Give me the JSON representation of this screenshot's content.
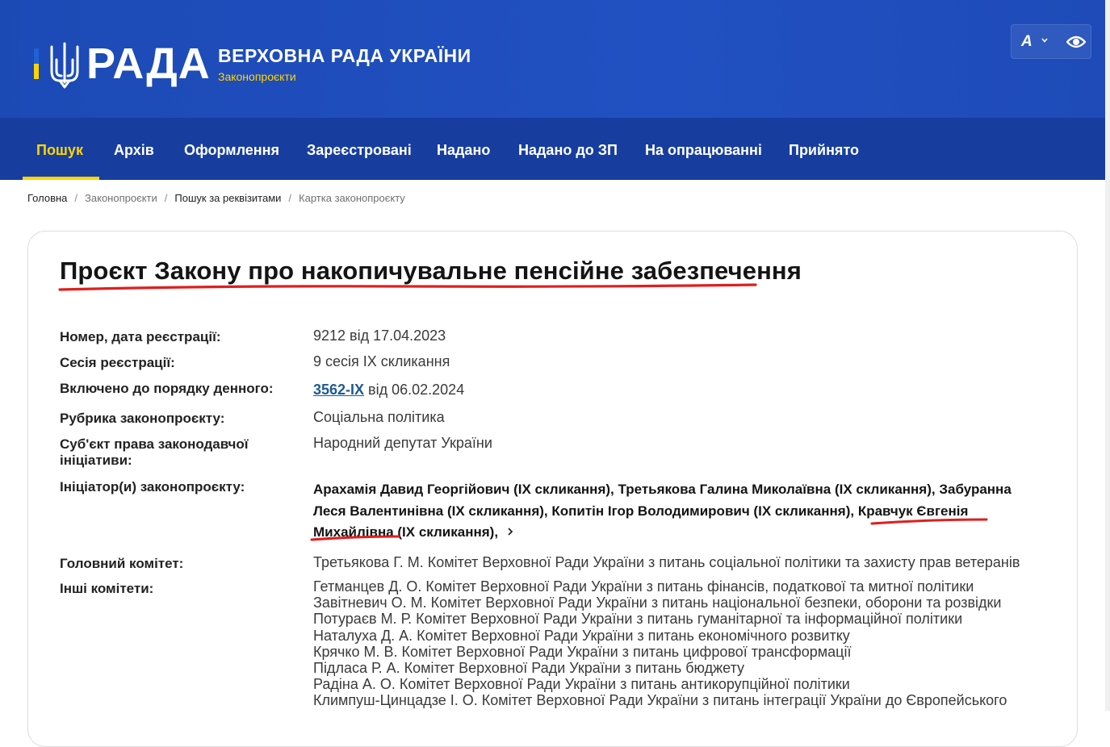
{
  "header": {
    "logo_word": "РАДА",
    "org_name": "ВЕРХОВНА РАДА УКРАЇНИ",
    "org_sub": "Законопроєкти",
    "font_button": "A"
  },
  "nav": {
    "items": [
      {
        "label": "Пошук",
        "active": true
      },
      {
        "label": "Архів"
      },
      {
        "label": "Оформлення"
      },
      {
        "label": "Зареєстровані"
      },
      {
        "label": "Надано"
      },
      {
        "label": "Надано до ЗП"
      },
      {
        "label": "На опрацюванні"
      },
      {
        "label": "Прийнято"
      }
    ]
  },
  "breadcrumbs": [
    "Головна",
    "Законопроєкти",
    "Пошук за реквізитами",
    "Картка законопроєкту"
  ],
  "bill": {
    "title": "Проєкт Закону про накопичувальне пенсійне забезпечення",
    "fields": [
      {
        "label": "Номер, дата реєстрації:",
        "value": "9212 від 17.04.2023"
      },
      {
        "label": "Сесія реєстрації:",
        "value": "9 сесія IX скликання"
      },
      {
        "label": "Включено до порядку денного:",
        "link": "3562-IX",
        "value": " від 06.02.2024"
      },
      {
        "label": "Рубрика законопроєкту:",
        "value": "Соціальна політика"
      },
      {
        "label_line1": "Суб'єкт права законодавчої",
        "label_line2": "ініціативи:",
        "value": "Народний депутат України"
      },
      {
        "label": "Ініціатор(и) законопроєкту:"
      },
      {
        "label": "Головний комітет:",
        "value": "Третьякова Г. М. Комітет Верховної Ради України з питань соціальної політики та захисту прав ветеранів"
      },
      {
        "label": "Інші комітети:"
      }
    ],
    "initiators": [
      "Арахамія Давид Георгійович (IX скликання)",
      "Третьякова Галина Миколаївна (IX скликання)",
      "Забуранна Леся Валентинівна (IX скликання)",
      "Копитін Ігор Володимирович (IX скликання)",
      "Кравчук Євгенія Михайлівна (IX скликання)"
    ],
    "initiators_line1": "Арахамія Давид Георгійович (IX скликання), Третьякова Галина Миколаївна (IX скликання), Забуранна",
    "initiators_line2": "Леся Валентинівна (IX скликання), Копитін Ігор Володимирович (IX скликання), Кравчук Євгенія",
    "initiators_line3": "Михайлівна (IX скликання),",
    "other_committees": [
      "Гетманцев Д. О. Комітет Верховної Ради України з питань фінансів, податкової та митної політики",
      "Завітневич О. М. Комітет Верховної Ради України з питань національної безпеки, оборони та розвідки",
      "Потураєв М. Р. Комітет Верховної Ради України з питань гуманітарної та інформаційної політики",
      "Наталуха Д. А. Комітет Верховної Ради України з питань економічного розвитку",
      "Крячко М. В. Комітет Верховної Ради України з питань цифрової трансформації",
      "Підласа Р. А. Комітет Верховної Ради України з питань бюджету",
      "Радіна А. О. Комітет Верховної Ради України з питань антикорупційної політики",
      "Климпуш-Цинцадзе І. О. Комітет Верховної Ради України з питань інтеграції України до Європейського"
    ]
  },
  "colors": {
    "header_blue": "#1e4bb8",
    "nav_blue": "#173e9f",
    "accent_yellow": "#ffd500",
    "link_blue": "#1d5a94",
    "annotation_red": "#e01e1e"
  }
}
